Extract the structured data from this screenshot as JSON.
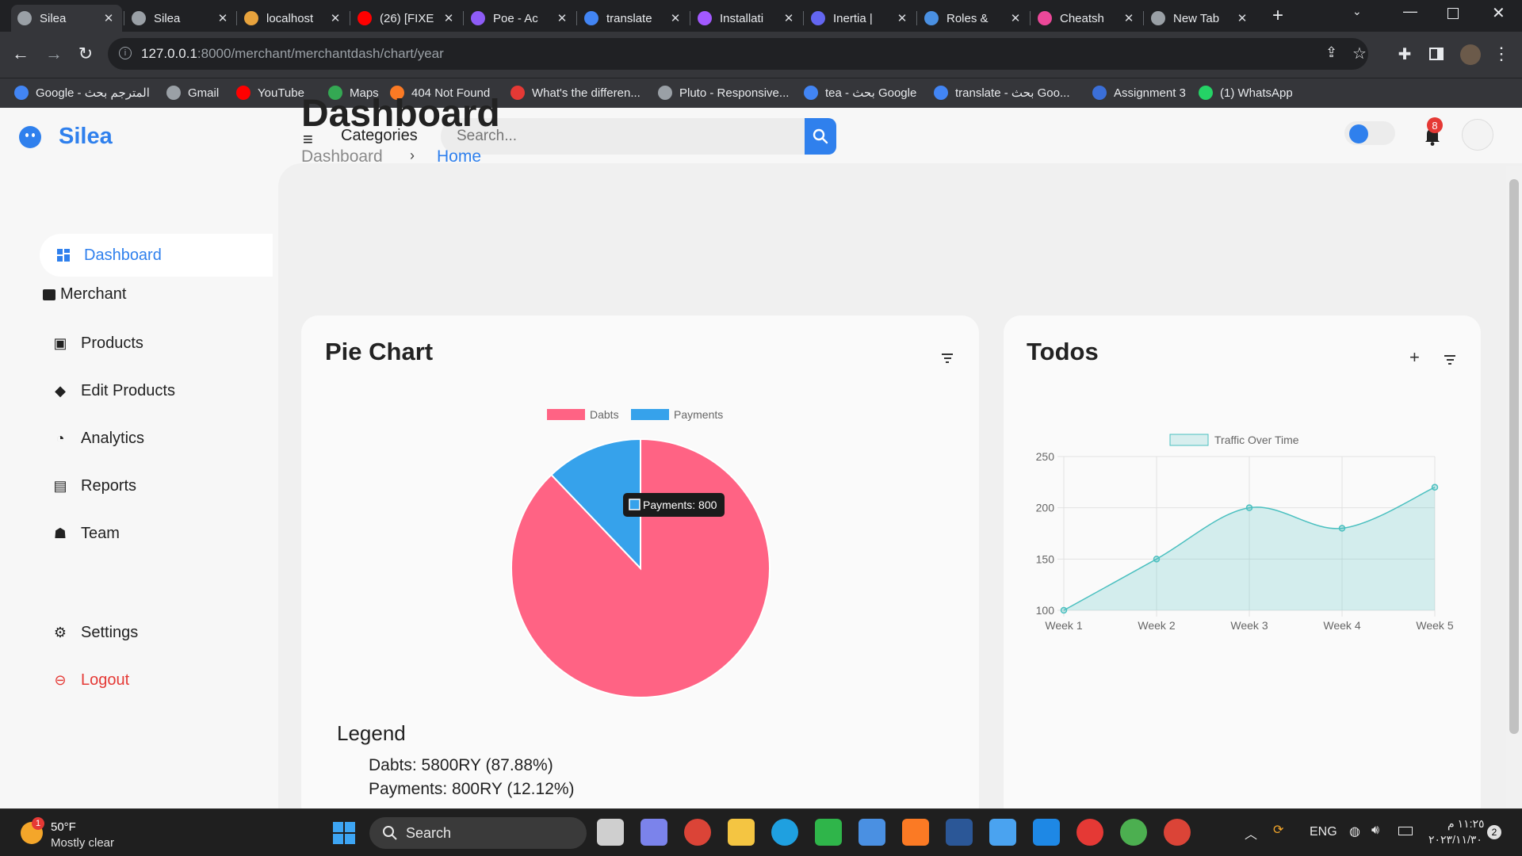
{
  "browser": {
    "tabs": [
      {
        "title": "Silea",
        "active": true,
        "color": "#9aa0a6"
      },
      {
        "title": "Silea",
        "color": "#9aa0a6"
      },
      {
        "title": "localhost",
        "color": "#e8a33d"
      },
      {
        "title": "(26) [FIXE",
        "color": "#ff0000"
      },
      {
        "title": "Poe - Ac",
        "color": "#8e5cf7"
      },
      {
        "title": "translate",
        "color": "#4285f4"
      },
      {
        "title": "Installati",
        "color": "#a259ff"
      },
      {
        "title": "Inertia |",
        "color": "#6366f1"
      },
      {
        "title": "Roles &",
        "color": "#4a90e2"
      },
      {
        "title": "Cheatsh",
        "color": "#ec4899"
      },
      {
        "title": "New Tab",
        "color": "#9aa0a6"
      }
    ],
    "url_host": "127.0.0.1",
    "url_path": ":8000/merchant/merchantdash/chart/year",
    "bookmarks": [
      {
        "label": "Google - المترجم بحث",
        "color": "#4285f4"
      },
      {
        "label": "Gmail",
        "color": "#9aa0a6"
      },
      {
        "label": "YouTube",
        "color": "#ff0000"
      },
      {
        "label": "Maps",
        "color": "#34a853"
      },
      {
        "label": "404 Not Found",
        "color": "#fb7a24"
      },
      {
        "label": "What's the differen...",
        "color": "#e53935"
      },
      {
        "label": "Pluto - Responsive...",
        "color": "#9aa0a6"
      },
      {
        "label": "tea - بحث Google",
        "color": "#4285f4"
      },
      {
        "label": "translate - بحث Goo...",
        "color": "#4285f4"
      },
      {
        "label": "Assignment 3",
        "color": "#3b6fd8"
      },
      {
        "label": "(1) WhatsApp",
        "color": "#25d366"
      }
    ]
  },
  "app": {
    "brand": "Silea",
    "categories_label": "Categories",
    "search_placeholder": "Search...",
    "notification_count": "8",
    "accent": "#2f80ed"
  },
  "sidebar": {
    "dashboard": "Dashboard",
    "merchant": "Merchant",
    "items": [
      {
        "label": "Products",
        "icon": "inbox-icon"
      },
      {
        "label": "Edit Products",
        "icon": "bag-icon"
      },
      {
        "label": "Analytics",
        "icon": "chart-icon"
      },
      {
        "label": "Reports",
        "icon": "chat-icon"
      },
      {
        "label": "Team",
        "icon": "users-icon"
      }
    ],
    "settings": "Settings",
    "logout": "Logout"
  },
  "main": {
    "title": "Dashboard",
    "breadcrumb": [
      "Dashboard",
      "Home"
    ]
  },
  "pie_card": {
    "title": "Pie Chart",
    "legend_title": "Legend",
    "legend_lines": [
      "Dabts: 5800RY (87.88%)",
      "Payments: 800RY (12.12%)"
    ],
    "tooltip": "Payments: 800"
  },
  "todo_card": {
    "title": "Todos"
  },
  "chart_data": [
    {
      "type": "pie",
      "categories": [
        "Dabts",
        "Payments"
      ],
      "values": [
        5800,
        800
      ],
      "colors": [
        "#ff6384",
        "#36a2eb"
      ],
      "legend": "top"
    },
    {
      "type": "area",
      "categories": [
        "Week 1",
        "Week 2",
        "Week 3",
        "Week 4",
        "Week 5"
      ],
      "series": [
        {
          "name": "Traffic Over Time",
          "values": [
            100,
            150,
            200,
            180,
            220
          ]
        }
      ],
      "ylim": [
        100,
        250
      ],
      "yticks": [
        100,
        150,
        200,
        250
      ],
      "grid": true,
      "color": "#4bc0c0",
      "legend": "top"
    }
  ],
  "taskbar": {
    "weather_temp": "50°F",
    "weather_desc": "Mostly clear",
    "weather_badge": "1",
    "search_label": "Search",
    "lang": "ENG",
    "time": "١١:٢٥ م",
    "date": "٢٠٢٣/١١/٣٠",
    "notif": "2"
  }
}
